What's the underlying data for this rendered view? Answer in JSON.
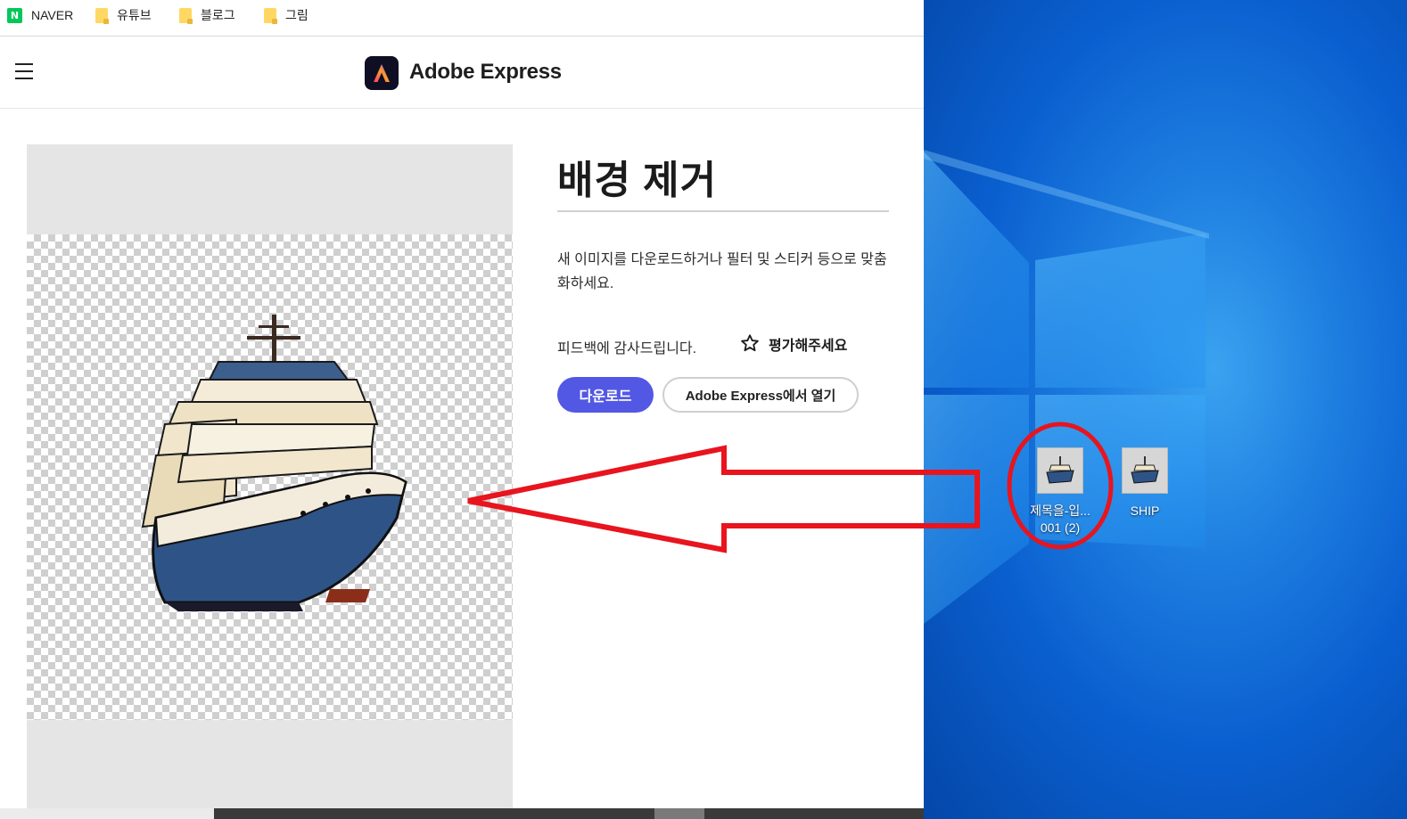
{
  "bookmarks": [
    {
      "label": "NAVER",
      "icon": "naver-icon"
    },
    {
      "label": "유튜브",
      "icon": "folder-icon"
    },
    {
      "label": "블로그",
      "icon": "folder-icon"
    },
    {
      "label": "그림",
      "icon": "folder-icon"
    }
  ],
  "header": {
    "brand": "Adobe Express",
    "naver_mark": "N"
  },
  "main": {
    "title": "배경 제거",
    "description": "새 이미지를 다운로드하거나 필터 및 스티커 등으로 맞춤화하세요.",
    "feedback": "피드백에 감사드립니다.",
    "rate_label": "평가해주세요",
    "download_label": "다운로드",
    "open_label": "Adobe Express에서 열기"
  },
  "desktop": {
    "icons": [
      {
        "label": "제목을-입... 001 (2)"
      },
      {
        "label": "SHIP"
      }
    ]
  },
  "colors": {
    "accent": "#5258e4",
    "annotation": "#e8141e",
    "desktop_blue": "#0a5fcf"
  }
}
